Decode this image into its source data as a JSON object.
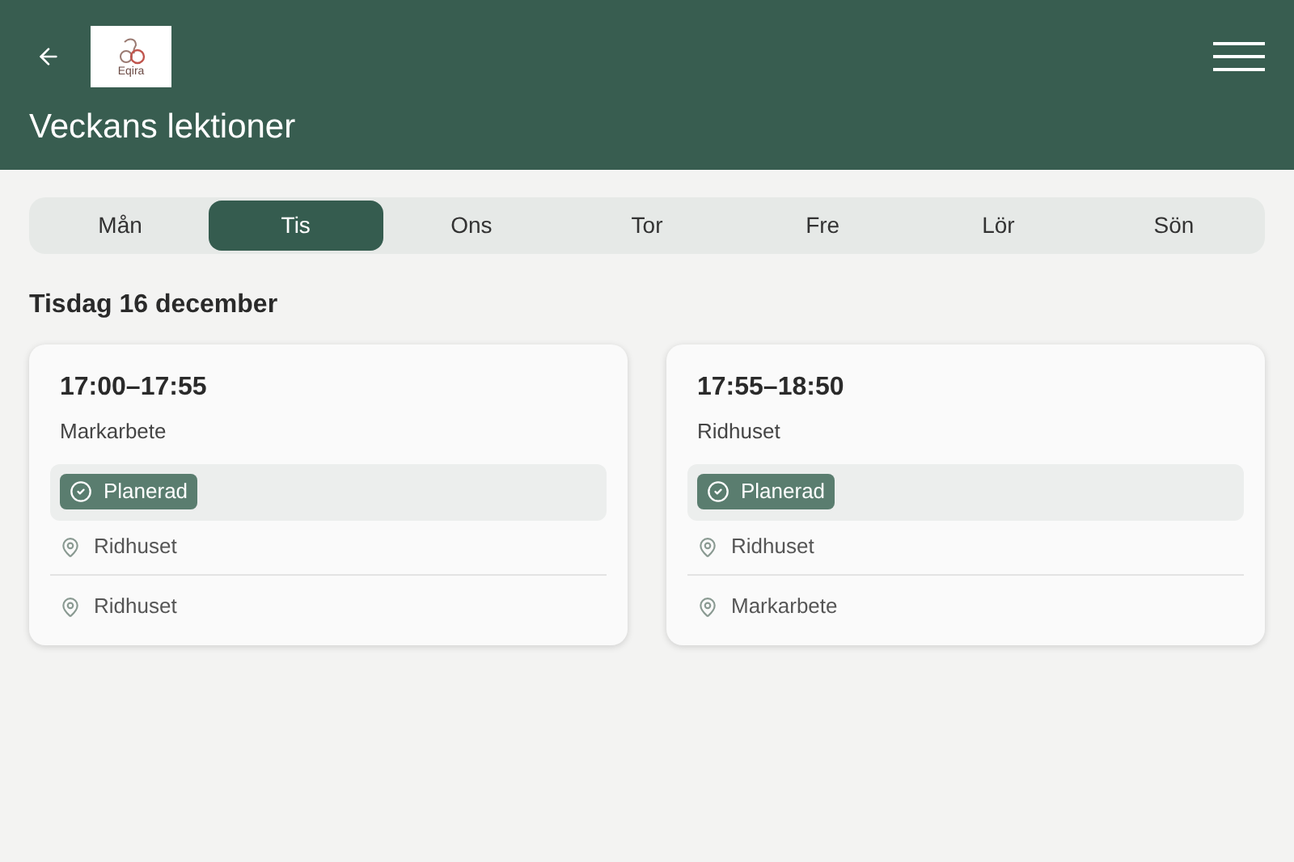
{
  "header": {
    "logo_text": "Eqira",
    "title": "Veckans lektioner"
  },
  "days": [
    {
      "label": "Mån",
      "selected": false
    },
    {
      "label": "Tis",
      "selected": true
    },
    {
      "label": "Ons",
      "selected": false
    },
    {
      "label": "Tor",
      "selected": false
    },
    {
      "label": "Fre",
      "selected": false
    },
    {
      "label": "Lör",
      "selected": false
    },
    {
      "label": "Sön",
      "selected": false
    }
  ],
  "date_heading": "Tisdag 16 december",
  "lessons": [
    {
      "time": "17:00–17:55",
      "name": "Markarbete",
      "status": "Planerad",
      "locations": [
        "Ridhuset",
        "Ridhuset"
      ]
    },
    {
      "time": "17:55–18:50",
      "name": "Ridhuset",
      "status": "Planerad",
      "locations": [
        "Ridhuset",
        "Markarbete"
      ]
    }
  ]
}
